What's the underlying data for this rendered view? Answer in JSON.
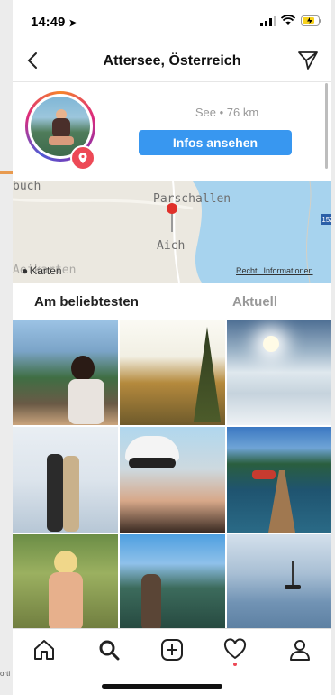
{
  "status": {
    "time": "14:49"
  },
  "nav": {
    "title": "Attersee, Österreich"
  },
  "location": {
    "meta": "See • 76 km",
    "info_button": "Infos ansehen"
  },
  "map": {
    "labels": [
      "buch",
      "Parschallen",
      "Aich",
      "Aeikarten"
    ],
    "karten_label": "Karten",
    "legal": "Rechtl. Informationen",
    "road_badge": "152"
  },
  "tabs": {
    "top": "Am beliebtesten",
    "recent": "Aktuell"
  },
  "background": {
    "fragment": "orti"
  },
  "icons": [
    "back-icon",
    "send-icon",
    "location-pin-icon",
    "home-icon",
    "search-icon",
    "add-icon",
    "heart-icon",
    "profile-icon"
  ],
  "colors": {
    "accent": "#3897f0",
    "badge": "#ed4956",
    "lake": "#a7d3ee"
  }
}
